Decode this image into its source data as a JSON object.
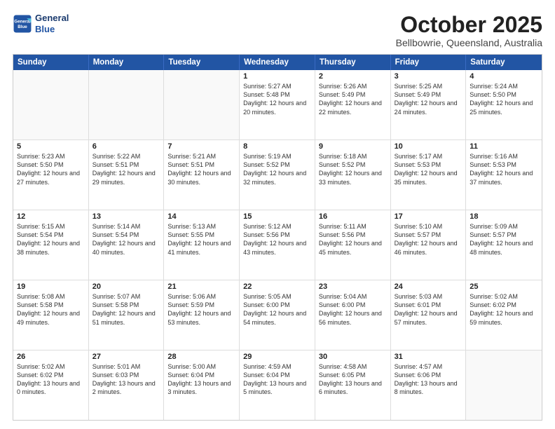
{
  "logo": {
    "line1": "General",
    "line2": "Blue"
  },
  "title": "October 2025",
  "subtitle": "Bellbowrie, Queensland, Australia",
  "header_days": [
    "Sunday",
    "Monday",
    "Tuesday",
    "Wednesday",
    "Thursday",
    "Friday",
    "Saturday"
  ],
  "weeks": [
    [
      {
        "day": "",
        "sunrise": "",
        "sunset": "",
        "daylight": ""
      },
      {
        "day": "",
        "sunrise": "",
        "sunset": "",
        "daylight": ""
      },
      {
        "day": "",
        "sunrise": "",
        "sunset": "",
        "daylight": ""
      },
      {
        "day": "1",
        "sunrise": "Sunrise: 5:27 AM",
        "sunset": "Sunset: 5:48 PM",
        "daylight": "Daylight: 12 hours and 20 minutes."
      },
      {
        "day": "2",
        "sunrise": "Sunrise: 5:26 AM",
        "sunset": "Sunset: 5:49 PM",
        "daylight": "Daylight: 12 hours and 22 minutes."
      },
      {
        "day": "3",
        "sunrise": "Sunrise: 5:25 AM",
        "sunset": "Sunset: 5:49 PM",
        "daylight": "Daylight: 12 hours and 24 minutes."
      },
      {
        "day": "4",
        "sunrise": "Sunrise: 5:24 AM",
        "sunset": "Sunset: 5:50 PM",
        "daylight": "Daylight: 12 hours and 25 minutes."
      }
    ],
    [
      {
        "day": "5",
        "sunrise": "Sunrise: 5:23 AM",
        "sunset": "Sunset: 5:50 PM",
        "daylight": "Daylight: 12 hours and 27 minutes."
      },
      {
        "day": "6",
        "sunrise": "Sunrise: 5:22 AM",
        "sunset": "Sunset: 5:51 PM",
        "daylight": "Daylight: 12 hours and 29 minutes."
      },
      {
        "day": "7",
        "sunrise": "Sunrise: 5:21 AM",
        "sunset": "Sunset: 5:51 PM",
        "daylight": "Daylight: 12 hours and 30 minutes."
      },
      {
        "day": "8",
        "sunrise": "Sunrise: 5:19 AM",
        "sunset": "Sunset: 5:52 PM",
        "daylight": "Daylight: 12 hours and 32 minutes."
      },
      {
        "day": "9",
        "sunrise": "Sunrise: 5:18 AM",
        "sunset": "Sunset: 5:52 PM",
        "daylight": "Daylight: 12 hours and 33 minutes."
      },
      {
        "day": "10",
        "sunrise": "Sunrise: 5:17 AM",
        "sunset": "Sunset: 5:53 PM",
        "daylight": "Daylight: 12 hours and 35 minutes."
      },
      {
        "day": "11",
        "sunrise": "Sunrise: 5:16 AM",
        "sunset": "Sunset: 5:53 PM",
        "daylight": "Daylight: 12 hours and 37 minutes."
      }
    ],
    [
      {
        "day": "12",
        "sunrise": "Sunrise: 5:15 AM",
        "sunset": "Sunset: 5:54 PM",
        "daylight": "Daylight: 12 hours and 38 minutes."
      },
      {
        "day": "13",
        "sunrise": "Sunrise: 5:14 AM",
        "sunset": "Sunset: 5:54 PM",
        "daylight": "Daylight: 12 hours and 40 minutes."
      },
      {
        "day": "14",
        "sunrise": "Sunrise: 5:13 AM",
        "sunset": "Sunset: 5:55 PM",
        "daylight": "Daylight: 12 hours and 41 minutes."
      },
      {
        "day": "15",
        "sunrise": "Sunrise: 5:12 AM",
        "sunset": "Sunset: 5:56 PM",
        "daylight": "Daylight: 12 hours and 43 minutes."
      },
      {
        "day": "16",
        "sunrise": "Sunrise: 5:11 AM",
        "sunset": "Sunset: 5:56 PM",
        "daylight": "Daylight: 12 hours and 45 minutes."
      },
      {
        "day": "17",
        "sunrise": "Sunrise: 5:10 AM",
        "sunset": "Sunset: 5:57 PM",
        "daylight": "Daylight: 12 hours and 46 minutes."
      },
      {
        "day": "18",
        "sunrise": "Sunrise: 5:09 AM",
        "sunset": "Sunset: 5:57 PM",
        "daylight": "Daylight: 12 hours and 48 minutes."
      }
    ],
    [
      {
        "day": "19",
        "sunrise": "Sunrise: 5:08 AM",
        "sunset": "Sunset: 5:58 PM",
        "daylight": "Daylight: 12 hours and 49 minutes."
      },
      {
        "day": "20",
        "sunrise": "Sunrise: 5:07 AM",
        "sunset": "Sunset: 5:58 PM",
        "daylight": "Daylight: 12 hours and 51 minutes."
      },
      {
        "day": "21",
        "sunrise": "Sunrise: 5:06 AM",
        "sunset": "Sunset: 5:59 PM",
        "daylight": "Daylight: 12 hours and 53 minutes."
      },
      {
        "day": "22",
        "sunrise": "Sunrise: 5:05 AM",
        "sunset": "Sunset: 6:00 PM",
        "daylight": "Daylight: 12 hours and 54 minutes."
      },
      {
        "day": "23",
        "sunrise": "Sunrise: 5:04 AM",
        "sunset": "Sunset: 6:00 PM",
        "daylight": "Daylight: 12 hours and 56 minutes."
      },
      {
        "day": "24",
        "sunrise": "Sunrise: 5:03 AM",
        "sunset": "Sunset: 6:01 PM",
        "daylight": "Daylight: 12 hours and 57 minutes."
      },
      {
        "day": "25",
        "sunrise": "Sunrise: 5:02 AM",
        "sunset": "Sunset: 6:02 PM",
        "daylight": "Daylight: 12 hours and 59 minutes."
      }
    ],
    [
      {
        "day": "26",
        "sunrise": "Sunrise: 5:02 AM",
        "sunset": "Sunset: 6:02 PM",
        "daylight": "Daylight: 13 hours and 0 minutes."
      },
      {
        "day": "27",
        "sunrise": "Sunrise: 5:01 AM",
        "sunset": "Sunset: 6:03 PM",
        "daylight": "Daylight: 13 hours and 2 minutes."
      },
      {
        "day": "28",
        "sunrise": "Sunrise: 5:00 AM",
        "sunset": "Sunset: 6:04 PM",
        "daylight": "Daylight: 13 hours and 3 minutes."
      },
      {
        "day": "29",
        "sunrise": "Sunrise: 4:59 AM",
        "sunset": "Sunset: 6:04 PM",
        "daylight": "Daylight: 13 hours and 5 minutes."
      },
      {
        "day": "30",
        "sunrise": "Sunrise: 4:58 AM",
        "sunset": "Sunset: 6:05 PM",
        "daylight": "Daylight: 13 hours and 6 minutes."
      },
      {
        "day": "31",
        "sunrise": "Sunrise: 4:57 AM",
        "sunset": "Sunset: 6:06 PM",
        "daylight": "Daylight: 13 hours and 8 minutes."
      },
      {
        "day": "",
        "sunrise": "",
        "sunset": "",
        "daylight": ""
      }
    ]
  ]
}
